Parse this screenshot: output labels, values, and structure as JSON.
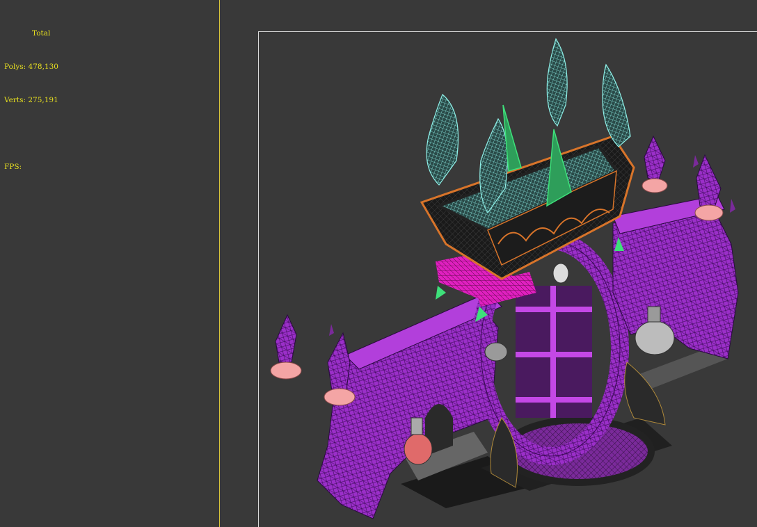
{
  "stats": {
    "total_label": "Total",
    "polys_label": "Polys:",
    "polys_value": "478,130",
    "verts_label": "Verts:",
    "verts_value": "275,191",
    "fps_label": "FPS:",
    "fps_value": ""
  },
  "colors": {
    "background": "#393939",
    "stats_text": "#e8e020",
    "divider": "#d8c43a",
    "safe_frame": "#d9d9d9",
    "purple_mesh": "#9b2fc9",
    "magenta_mesh": "#e020c0",
    "cyan_wire": "#8ff0e8",
    "green_wire": "#3ee07a",
    "pink_wire": "#f4a5a5",
    "orange_wire": "#d8742a"
  },
  "viewport": {
    "object": "3d-model-purple-fantasy-gate-wireframe"
  }
}
